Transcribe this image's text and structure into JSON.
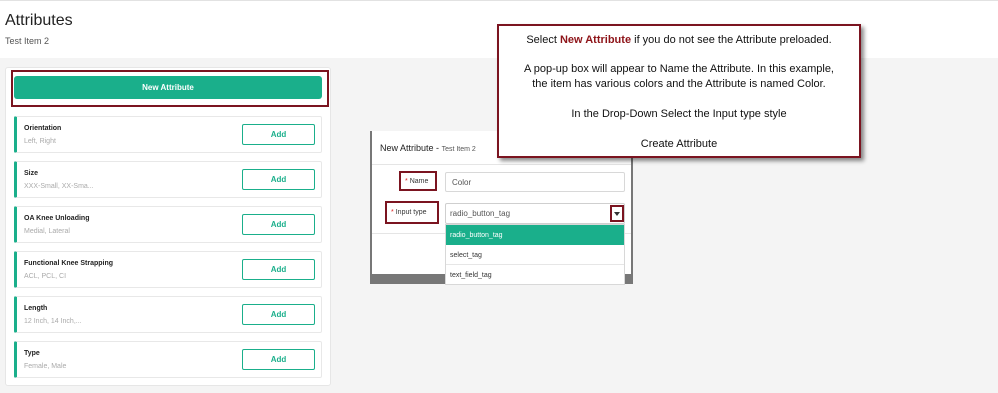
{
  "header": {
    "title": "Attributes",
    "subtitle": "Test Item 2"
  },
  "toolbar": {
    "new_attribute_label": "New Attribute"
  },
  "attributes": [
    {
      "name": "Orientation",
      "values": "Left, Right",
      "add_label": "Add"
    },
    {
      "name": "Size",
      "values": "XXX-Small, XX-Sma...",
      "add_label": "Add"
    },
    {
      "name": "OA Knee Unloading",
      "values": "Medial, Lateral",
      "add_label": "Add"
    },
    {
      "name": "Functional Knee Strapping",
      "values": "ACL, PCL, CI",
      "add_label": "Add"
    },
    {
      "name": "Length",
      "values": "12 Inch, 14 Inch,...",
      "add_label": "Add"
    },
    {
      "name": "Type",
      "values": "Female, Male",
      "add_label": "Add"
    }
  ],
  "modal": {
    "title": "New Attribute",
    "title_separator": "-",
    "subtitle": "Test Item 2",
    "name_required_mark": "*",
    "name_label": "Name",
    "name_value": "Color",
    "input_type_required_mark": "*",
    "input_type_label": "Input type",
    "input_type_value": "radio_button_tag",
    "dropdown_options": [
      "radio_button_tag",
      "select_tag",
      "text_field_tag"
    ],
    "selected_option_index": 0
  },
  "callout": {
    "line1_prefix": "Select ",
    "line1_emphasis": "New Attribute",
    "line1_suffix": " if you do not see the Attribute preloaded.",
    "line2": "A pop-up box will appear to Name the Attribute.  In this example,",
    "line3": "the item has various colors and the Attribute is named Color.",
    "line4": "In the Drop-Down Select the Input type style",
    "line5": "Create Attribute"
  },
  "icons": {
    "dropdown_chevron": "chevron-down-icon"
  },
  "colors": {
    "accent": "#1aaf8b",
    "highlight_border": "#7b1420",
    "callout_emphasis": "#8e1419"
  }
}
